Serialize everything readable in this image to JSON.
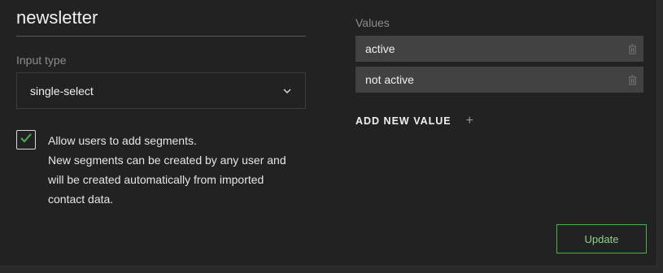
{
  "segment": {
    "name": "newsletter"
  },
  "input_type": {
    "label": "Input type",
    "selected": "single-select",
    "icon": "chevron-down-icon"
  },
  "allow_users": {
    "checked": true,
    "line1": "Allow users to add segments.",
    "line2": "New segments can be created by any user and",
    "line3": "will be created automatically from imported",
    "line4": "contact data."
  },
  "values": {
    "label": "Values",
    "items": [
      {
        "label": "active"
      },
      {
        "label": "not active"
      }
    ],
    "add_label": "ADD NEW VALUE",
    "add_icon": "+"
  },
  "actions": {
    "update_label": "Update"
  },
  "colors": {
    "accent": "#4caf50",
    "panel": "#222222",
    "value_bg": "#424242"
  }
}
